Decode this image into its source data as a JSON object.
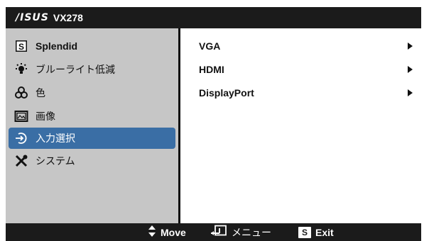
{
  "title_bar": {
    "brand": "/ISUS",
    "model": "VX278"
  },
  "sidebar": {
    "items": [
      {
        "label": "Splendid",
        "icon": "splendid-s-icon"
      },
      {
        "label": "ブルーライト低減",
        "icon": "bluelight-icon"
      },
      {
        "label": "色",
        "icon": "color-icon"
      },
      {
        "label": "画像",
        "icon": "image-icon"
      },
      {
        "label": "入力選択",
        "icon": "input-select-icon",
        "selected": true
      },
      {
        "label": "システム",
        "icon": "tools-icon"
      }
    ]
  },
  "content": {
    "options": [
      {
        "label": "VGA"
      },
      {
        "label": "HDMI"
      },
      {
        "label": "DisplayPort"
      }
    ]
  },
  "footer": {
    "move_label": "Move",
    "menu_label": "メニュー",
    "exit_key": "S",
    "exit_label": "Exit"
  },
  "colors": {
    "bar_bg": "#1b1b1b",
    "sidebar_bg": "#c6c6c6",
    "selected_bg": "#3a6ea5"
  }
}
